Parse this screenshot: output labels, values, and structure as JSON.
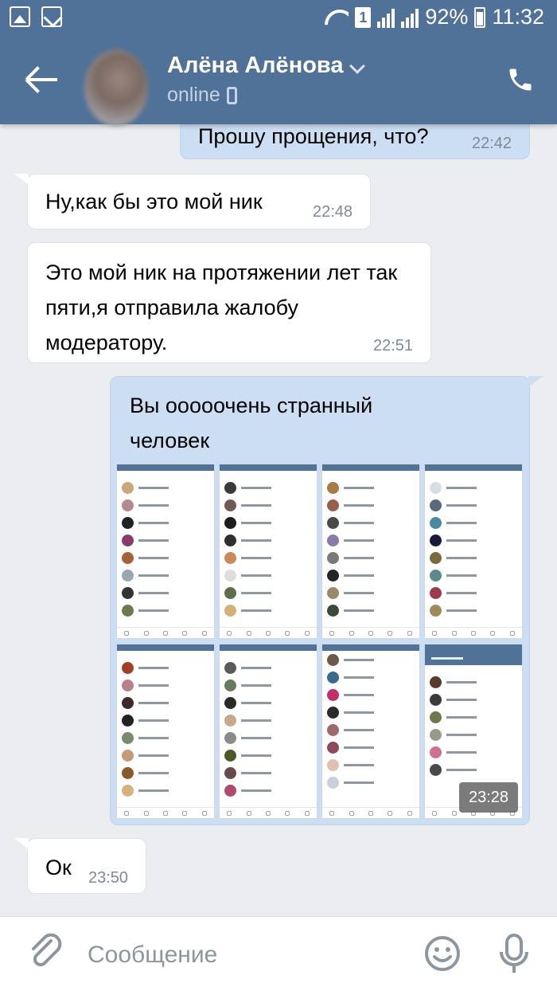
{
  "status_bar": {
    "battery": "92%",
    "time": "11:32",
    "sim": "1"
  },
  "header": {
    "contact_name": "Алёна Алёнова",
    "status": "online"
  },
  "messages": [
    {
      "direction": "out",
      "text": "Прошу прощения, что?",
      "time": "22:42"
    },
    {
      "direction": "in",
      "text": "Ну,как бы это мой ник",
      "time": "22:48"
    },
    {
      "direction": "in",
      "text": "Это мой ник на протяжении лет так пяти,я отправила жалобу модератору.",
      "time": "22:51"
    },
    {
      "direction": "out",
      "text": "Вы ооооочень странный человек",
      "time": "23:28"
    },
    {
      "direction": "in",
      "text": "Ок",
      "time": "23:50"
    }
  ],
  "input": {
    "placeholder": "Сообщение"
  },
  "colors": {
    "header": "#507299",
    "outgoing_bubble": "#ccdef3",
    "incoming_bubble": "#ffffff",
    "background": "#ebedf0"
  },
  "icons": [
    "image-icon",
    "blocked-icon",
    "wifi-icon",
    "signal-icon",
    "battery-icon",
    "back-arrow-icon",
    "phone-icon",
    "paperclip-icon",
    "emoji-icon",
    "microphone-icon"
  ]
}
